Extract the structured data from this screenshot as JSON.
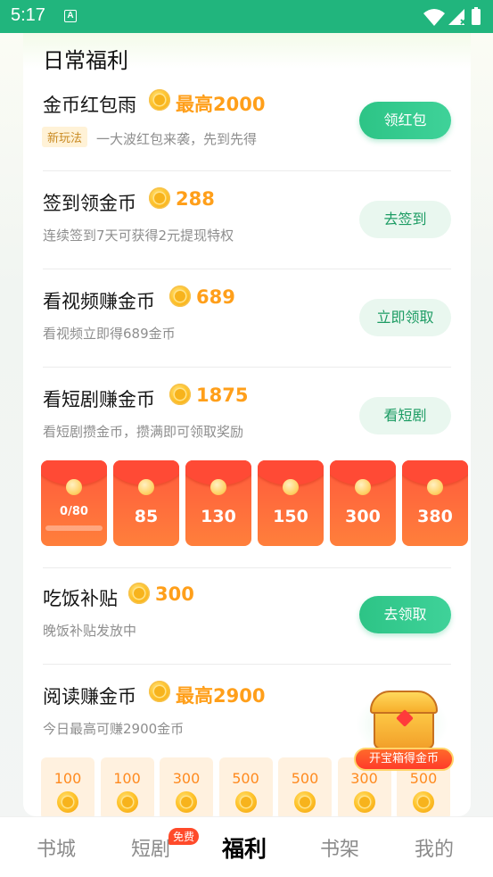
{
  "status_bar": {
    "time": "5:17",
    "a_icon": "A"
  },
  "section": {
    "title": "日常福利"
  },
  "tasks": [
    {
      "title": "金币红包雨",
      "reward": "最高2000",
      "tag": "新玩法",
      "subtitle": "一大波红包来袭，先到先得",
      "button": "领红包"
    },
    {
      "title": "签到领金币",
      "reward": "288",
      "subtitle": "连续签到7天可获得2元提现特权",
      "button": "去签到"
    },
    {
      "title": "看视频赚金币",
      "reward": "689",
      "subtitle": "看视频立即得689金币",
      "button": "立即领取"
    },
    {
      "title": "看短剧赚金币",
      "reward": "1875",
      "subtitle": "看短剧攒金币，攒满即可领取奖励",
      "button": "看短剧"
    },
    {
      "title": "吃饭补贴",
      "reward": "300",
      "subtitle": "晚饭补贴发放中",
      "button": "去领取"
    },
    {
      "title": "阅读赚金币",
      "reward": "最高2900",
      "subtitle": "今日最高可赚2900金币"
    }
  ],
  "red_packets": [
    "0/80",
    "85",
    "130",
    "150",
    "300",
    "380"
  ],
  "red_packet_progress": 0,
  "reading_coins": [
    "100",
    "100",
    "300",
    "500",
    "500",
    "300",
    "500"
  ],
  "treasure_chest": {
    "label": "开宝箱得金币"
  },
  "tab_bar": {
    "items": [
      "书城",
      "短剧",
      "福利",
      "书架",
      "我的"
    ],
    "active": "福利",
    "badge": "免费"
  },
  "colors": {
    "accent": "#21b57d",
    "reward": "#ff9f1a",
    "packet": "#ff5a3d"
  },
  "icons": [
    "coin-icon",
    "wifi-icon",
    "signal-icon",
    "battery-icon",
    "treasure-chest-icon"
  ]
}
